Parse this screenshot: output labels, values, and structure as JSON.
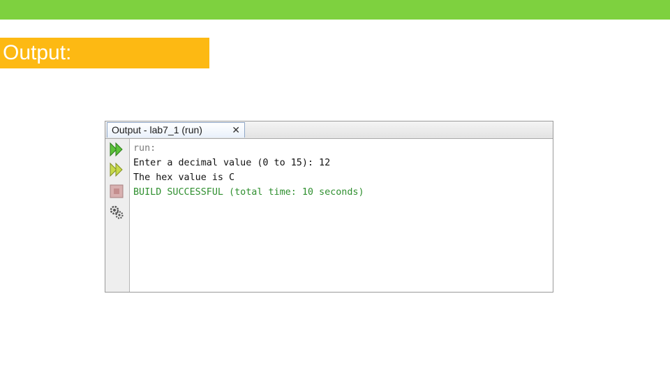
{
  "slide": {
    "section_label": "Output:"
  },
  "ide": {
    "tab_title": "Output - lab7_1 (run)",
    "tab_close": "✕",
    "gutter_icons": [
      "rerun-icon",
      "rerun-with-options-icon",
      "stop-icon",
      "settings-icon"
    ],
    "lines": [
      {
        "text": "run:",
        "style": "muted"
      },
      {
        "text": "Enter a decimal value (0 to 15): 12",
        "style": "normal"
      },
      {
        "text": "The hex value is C",
        "style": "normal"
      },
      {
        "text": "BUILD SUCCESSFUL (total time: 10 seconds)",
        "style": "success"
      }
    ]
  },
  "colors": {
    "top_bar": "#7ed13f",
    "label_bg": "#fdb913",
    "success_text": "#2f8f2f"
  }
}
